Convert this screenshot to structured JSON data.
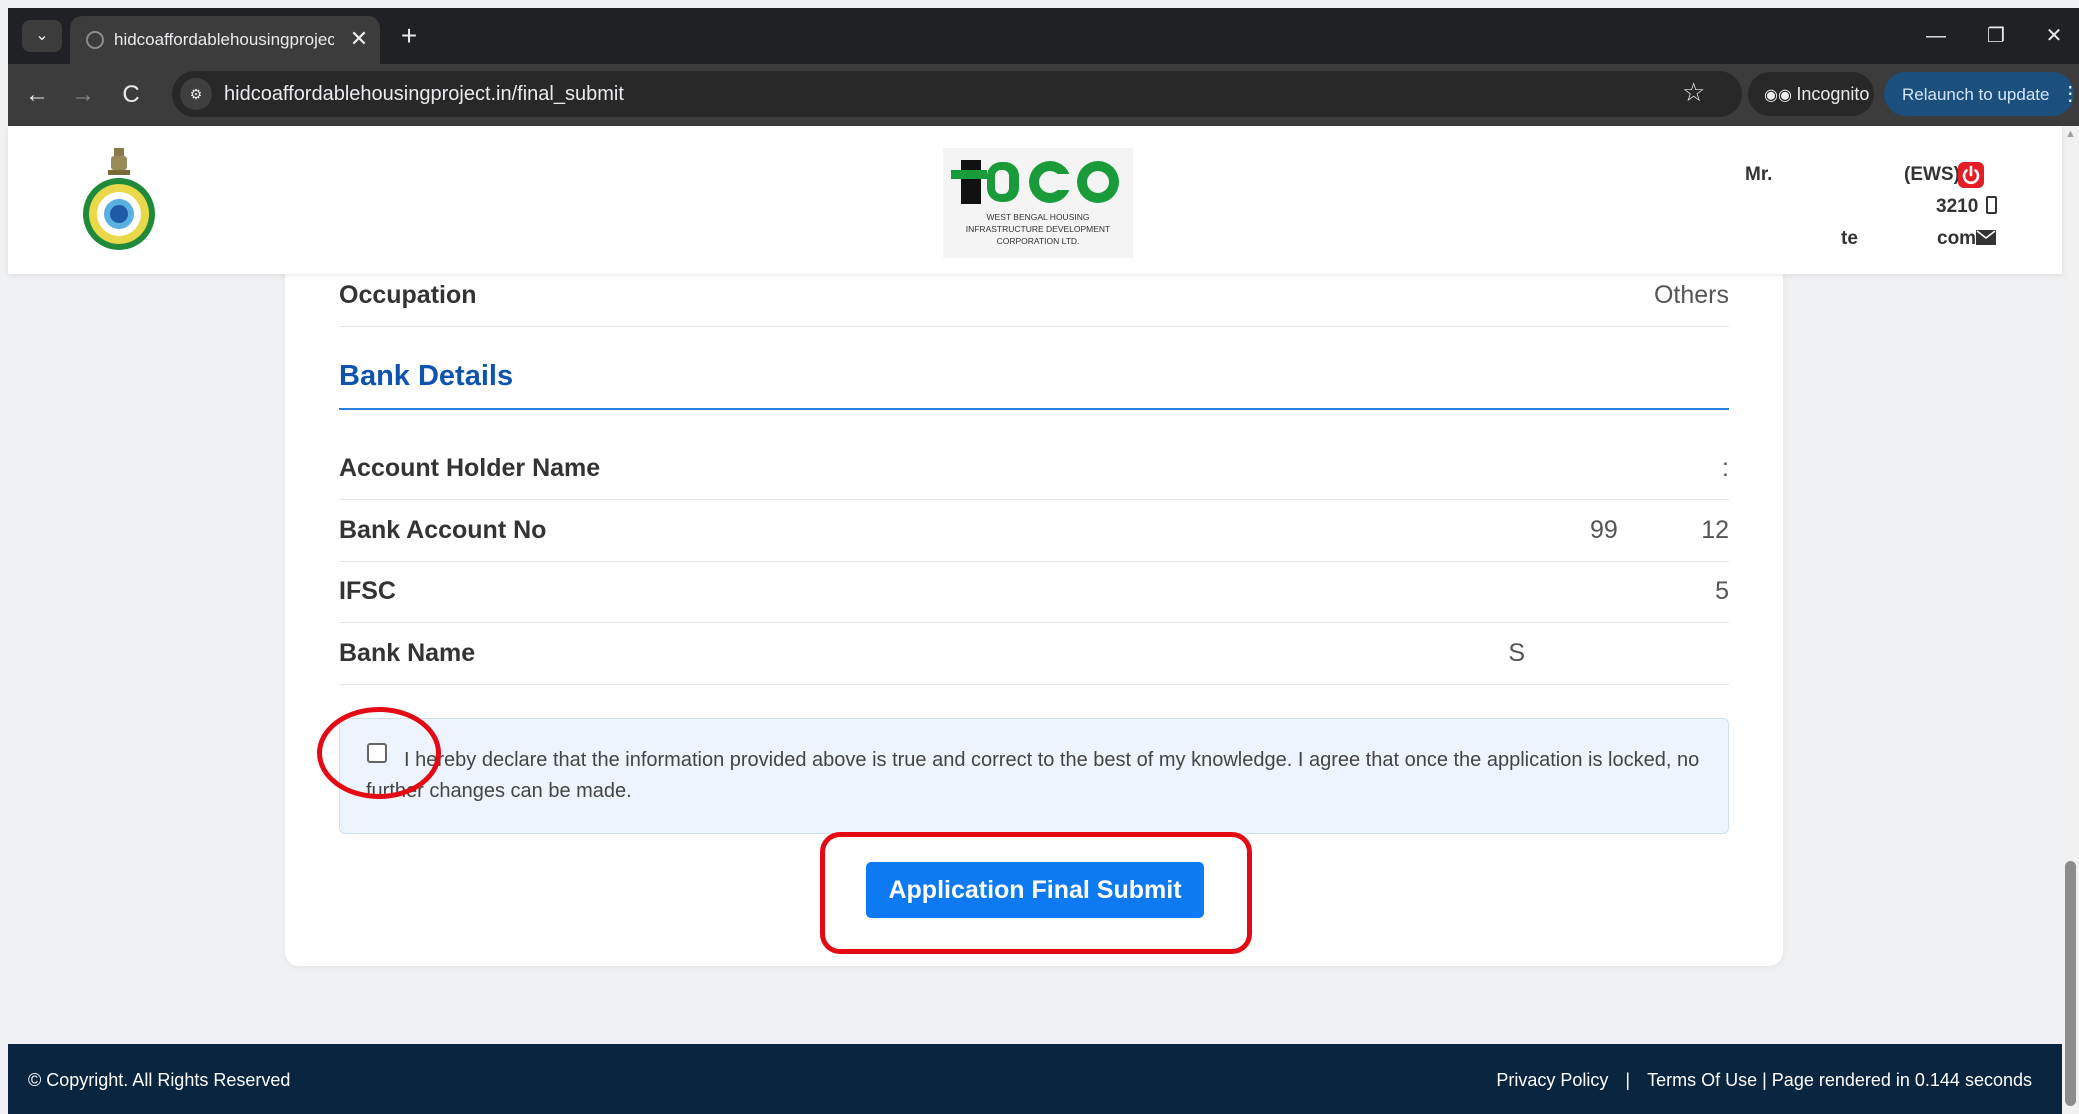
{
  "browser": {
    "tab_title": "hidcoaffordablehousingproject.",
    "tab_close": "✕",
    "new_tab": "+",
    "url": "hidcoaffordablehousingproject.in/final_submit",
    "incognito_label": "Incognito",
    "relaunch_label": "Relaunch to update",
    "icons": {
      "back": "←",
      "forward": "→",
      "reload": "C",
      "tab_list": "⌄",
      "site_info": "⚙",
      "bookmark": "☆",
      "minimize": "—",
      "restore": "❐",
      "close": "✕",
      "menu": "⋮"
    }
  },
  "header": {
    "logo_text": "HIDCO",
    "logo_subtitle": [
      "WEST BENGAL HOUSING",
      "INFRASTRUCTURE DEVELOPMENT",
      "CORPORATION LTD."
    ],
    "user_name": "Mr.",
    "user_category": "(EWS)",
    "user_phone": "3210",
    "user_email_prefix": "te",
    "user_email_suffix": "com"
  },
  "details": {
    "occupation_label": "Occupation",
    "occupation_value": "Others",
    "bank_section_title": "Bank Details",
    "rows": [
      {
        "label": "Account Holder Name",
        "value": ":"
      },
      {
        "label": "Bank Account No",
        "value": "99            12"
      },
      {
        "label": "IFSC",
        "value": "5"
      },
      {
        "label": "Bank Name",
        "value": "S"
      }
    ]
  },
  "declaration": {
    "text": "I hereby declare that the information provided above is true and correct to the best of my knowledge. I agree that once the application is locked, no further changes can be made.",
    "checked": false
  },
  "submit_label": "Application Final Submit",
  "footer": {
    "copyright": "© Copyright. All Rights Reserved",
    "privacy": "Privacy Policy",
    "separator": "|",
    "terms": "Terms Of Use | Page rendered in 0.144 seconds"
  },
  "colors": {
    "accent_blue": "#0d7af3",
    "section_title": "#0d54b0",
    "footer_bg": "#0a2540",
    "annotation_red": "#e50914",
    "logo_green": "#1a9b3a"
  }
}
